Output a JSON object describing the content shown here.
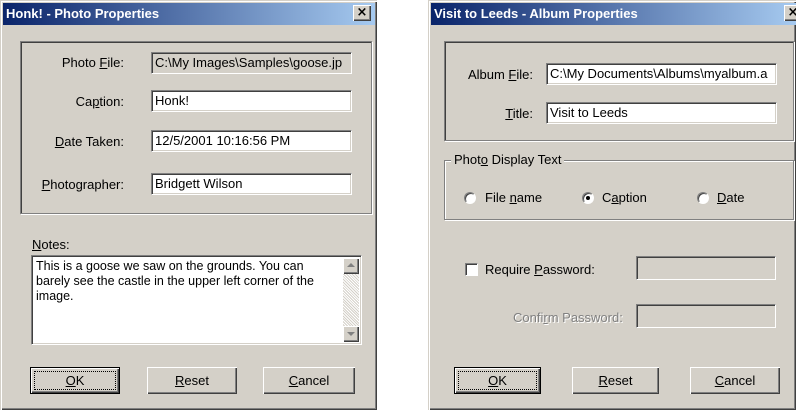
{
  "photo_dialog": {
    "title": "Honk! - Photo Properties",
    "close_glyph": "×",
    "fields": {
      "photo_file": {
        "label_pre": "Photo ",
        "label_key": "F",
        "label_post": "ile:",
        "value": "C:\\My Images\\Samples\\goose.jp"
      },
      "caption": {
        "label_pre": "Ca",
        "label_key": "p",
        "label_post": "tion:",
        "value": "Honk!"
      },
      "date_taken": {
        "label_pre": "",
        "label_key": "D",
        "label_post": "ate Taken:",
        "value": "12/5/2001 10:16:56 PM"
      },
      "photographer": {
        "label_pre": "",
        "label_key": "P",
        "label_post": "hotographer:",
        "value": "Bridgett Wilson"
      }
    },
    "notes": {
      "label_pre": "",
      "label_key": "N",
      "label_post": "otes:",
      "text": "This is a goose we saw on the grounds.  You can barely see the castle in the upper left corner of the image."
    },
    "buttons": {
      "ok": {
        "pre": "",
        "key": "O",
        "post": "K"
      },
      "reset": {
        "pre": "",
        "key": "R",
        "post": "eset"
      },
      "cancel": {
        "pre": "",
        "key": "C",
        "post": "ancel"
      }
    }
  },
  "album_dialog": {
    "title": "Visit to Leeds - Album Properties",
    "close_glyph": "×",
    "fields": {
      "album_file": {
        "label_pre": "Album ",
        "label_key": "F",
        "label_post": "ile:",
        "value": "C:\\My Documents\\Albums\\myalbum.a"
      },
      "title": {
        "label_pre": "",
        "label_key": "T",
        "label_post": "itle:",
        "value": "Visit to Leeds"
      }
    },
    "display_text": {
      "legend_pre": "Phot",
      "legend_key": "o",
      "legend_post": " Display Text",
      "options": [
        {
          "pre": "File ",
          "key": "n",
          "post": "ame",
          "checked": false
        },
        {
          "pre": "C",
          "key": "a",
          "post": "ption",
          "checked": true
        },
        {
          "pre": "",
          "key": "D",
          "post": "ate",
          "checked": false
        }
      ]
    },
    "require_password": {
      "pre": "Require ",
      "key": "P",
      "post": "assword:",
      "checked": false
    },
    "confirm_password": {
      "pre": "Confi",
      "key": "r",
      "post": "m Password:"
    },
    "buttons": {
      "ok": {
        "pre": "",
        "key": "O",
        "post": "K"
      },
      "reset": {
        "pre": "",
        "key": "R",
        "post": "eset"
      },
      "cancel": {
        "pre": "",
        "key": "C",
        "post": "ancel"
      }
    }
  }
}
